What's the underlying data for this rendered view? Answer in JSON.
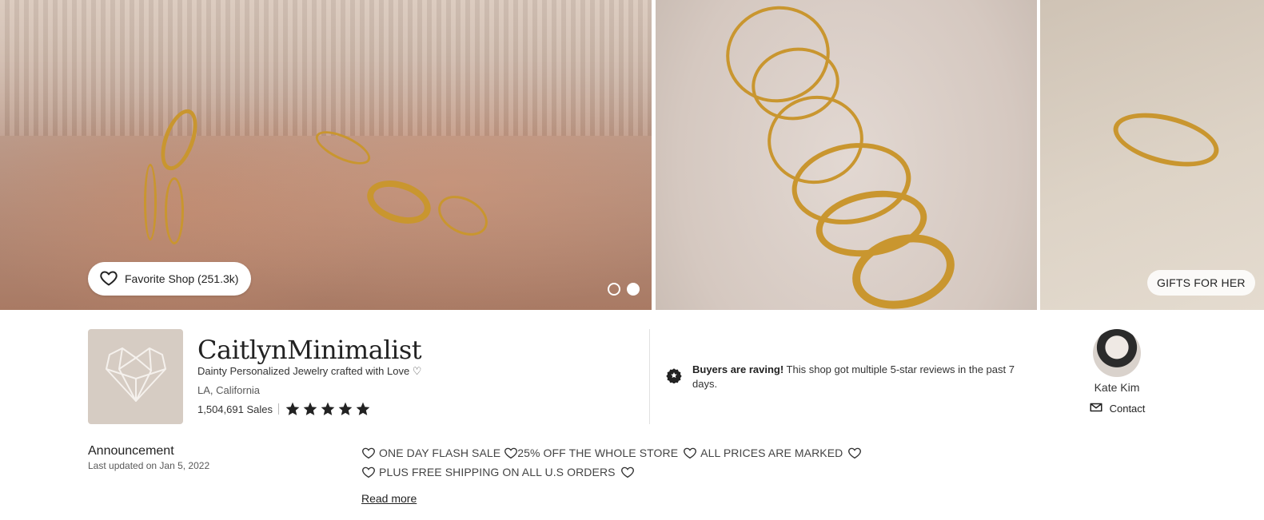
{
  "banner": {
    "favorite_button": {
      "label": "Favorite Shop (251.3k)",
      "icon": "heart-outline-icon"
    },
    "carousel": {
      "page_count": 2,
      "active_index": 1
    },
    "gifts_button": {
      "label": "GIFTS FOR HER"
    }
  },
  "shop": {
    "name": "CaitlynMinimalist",
    "tagline": "Dainty Personalized Jewelry crafted with Love ♡",
    "location": "LA, California",
    "sales": "1,504,691 Sales",
    "rating_stars": 5,
    "logo_icon": "heart-geometric-logo"
  },
  "highlight": {
    "icon": "star-badge-icon",
    "bold": "Buyers are raving!",
    "text": " This shop got multiple 5-star reviews in the past 7 days."
  },
  "owner": {
    "name": "Kate Kim",
    "contact_label": "Contact",
    "contact_icon": "mail-icon"
  },
  "announcement": {
    "title": "Announcement",
    "updated": "Last updated on Jan 5, 2022",
    "line1": [
      "ONE DAY FLASH SALE",
      "25% OFF THE WHOLE STORE",
      "ALL PRICES ARE MARKED"
    ],
    "line2": "PLUS FREE SHIPPING ON ALL U.S ORDERS",
    "read_more": "Read more"
  },
  "colors": {
    "text": "#222222",
    "muted": "#595959",
    "logo_bg": "#d6ccc3",
    "gold": "#c9962f"
  }
}
